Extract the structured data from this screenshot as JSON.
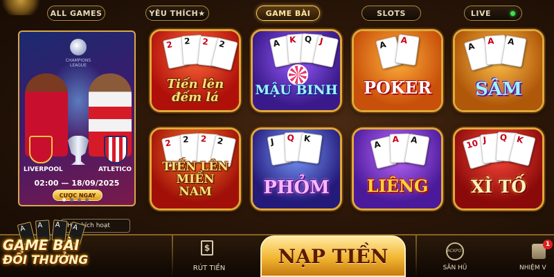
{
  "tabs": [
    {
      "label": "ALL GAMES",
      "active": false
    },
    {
      "label": "YÊU THÍCH★",
      "active": false
    },
    {
      "label": "GAME BÀI",
      "active": true
    },
    {
      "label": "SLOTS",
      "active": false
    },
    {
      "label": "LIVE",
      "active": false
    }
  ],
  "promo": {
    "league_text": "CHAMPIONS LEAGUE",
    "team_home": "LIVERPOOL",
    "team_away": "ATLETICO",
    "match_time": "02:00 — 18/09/2025",
    "button": "CƯỢC NGAY",
    "slides": 4,
    "active_slide": 1
  },
  "games": [
    {
      "title": "Tiến lên đếm lá"
    },
    {
      "title": "MẬU BINH"
    },
    {
      "title": "POKER"
    },
    {
      "title": "SÂM"
    },
    {
      "title": "TIẾN LÊN MIỀN NAM"
    },
    {
      "title": "PHỎM"
    },
    {
      "title": "LIÊNG"
    },
    {
      "title": "XÌ TỐ"
    }
  ],
  "cards": {
    "rank_2": "2",
    "rank_A": "A",
    "rank_K": "K",
    "rank_Q": "Q",
    "rank_J": "J",
    "rank_10": "10",
    "heart": "♥",
    "spade": "♠"
  },
  "bottom": {
    "activate": "Hãy kích hoạt",
    "brand_line1": "GAME BÀI",
    "brand_line2": "ĐỔI THƯỞNG",
    "withdraw": "RÚT TIỀN",
    "withdraw_icon": "$",
    "deposit": "NẠP TIỀN",
    "jackpot_icon_text": "JACKPOT",
    "jackpot": "SĂN HŨ",
    "mission": "NHIỆM V",
    "mission_badge": "1"
  },
  "colors": {
    "gold_border": "#e0a93a",
    "accent_live": "#3ce34b"
  }
}
